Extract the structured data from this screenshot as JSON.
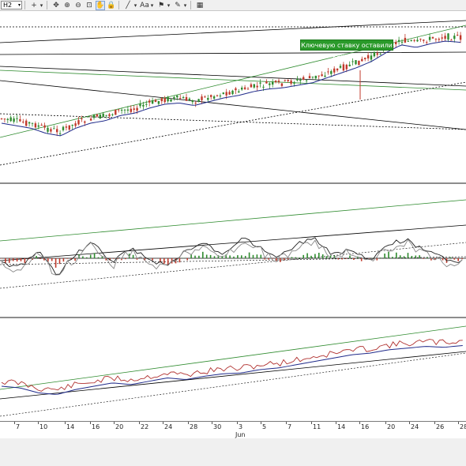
{
  "toolbar": {
    "timeframe": "H2",
    "tools": [
      {
        "name": "crosshair-icon",
        "glyph": "+"
      },
      {
        "name": "chevron-down-icon",
        "glyph": "▾"
      },
      {
        "name": "move-icon",
        "glyph": "✥"
      },
      {
        "name": "zoom-in-icon",
        "glyph": "⊕"
      },
      {
        "name": "zoom-out-icon",
        "glyph": "⊖"
      },
      {
        "name": "zoom-fit-icon",
        "glyph": "⊡"
      },
      {
        "name": "hand-icon",
        "glyph": "✋"
      },
      {
        "name": "lock-icon",
        "glyph": "🔒"
      },
      {
        "name": "line-tool-icon",
        "glyph": "╱"
      },
      {
        "name": "chevron-down-icon",
        "glyph": "▾"
      },
      {
        "name": "text-tool-icon",
        "glyph": "Aa"
      },
      {
        "name": "chevron-down-icon",
        "glyph": "▾"
      },
      {
        "name": "flag-icon",
        "glyph": "⚑"
      },
      {
        "name": "chevron-down-icon",
        "glyph": "▾"
      },
      {
        "name": "objects-icon",
        "glyph": "✎"
      },
      {
        "name": "chevron-down-icon",
        "glyph": "▾"
      },
      {
        "name": "grid-icon",
        "glyph": "▦"
      }
    ]
  },
  "news_label": "Ключевую ставку оставили как есть",
  "axis": {
    "ticks": [
      "7",
      "10",
      "14",
      "16",
      "20",
      "22",
      "24",
      "28",
      "30",
      "3",
      "5",
      "7",
      "11",
      "14",
      "16",
      "20",
      "24",
      "26",
      "28"
    ],
    "month": "Jun"
  },
  "colors": {
    "bull_candle": "#2e8b2e",
    "bear_candle": "#c0392b",
    "ma_line": "#1f2a8a",
    "trend_black": "#000000",
    "trend_green": "#2e8b2e",
    "rsi_line": "#b0302e",
    "news_bg": "#2a9a2a"
  },
  "chart_data": {
    "type": "line",
    "title": "",
    "price_trend": [
      0.3,
      0.28,
      0.26,
      0.22,
      0.2,
      0.26,
      0.3,
      0.32,
      0.36,
      0.38,
      0.42,
      0.45,
      0.46,
      0.44,
      0.47,
      0.5,
      0.52,
      0.55,
      0.57,
      0.58,
      0.6,
      0.62,
      0.66,
      0.7,
      0.74,
      0.79,
      0.86,
      0.92,
      0.9,
      0.93,
      0.95,
      0.94
    ],
    "oscillator_trend": [
      0.45,
      0.4,
      0.6,
      0.3,
      0.55,
      0.7,
      0.45,
      0.62,
      0.5,
      0.4,
      0.58,
      0.66,
      0.55,
      0.74,
      0.62,
      0.5,
      0.66,
      0.72,
      0.54,
      0.6,
      0.48,
      0.66,
      0.72,
      0.58,
      0.5,
      0.46
    ],
    "rsi_trend": [
      0.4,
      0.38,
      0.32,
      0.3,
      0.36,
      0.4,
      0.44,
      0.42,
      0.46,
      0.5,
      0.48,
      0.52,
      0.55,
      0.56,
      0.6,
      0.62,
      0.66,
      0.7,
      0.74,
      0.78,
      0.8,
      0.84,
      0.86,
      0.88,
      0.87,
      0.89
    ]
  }
}
